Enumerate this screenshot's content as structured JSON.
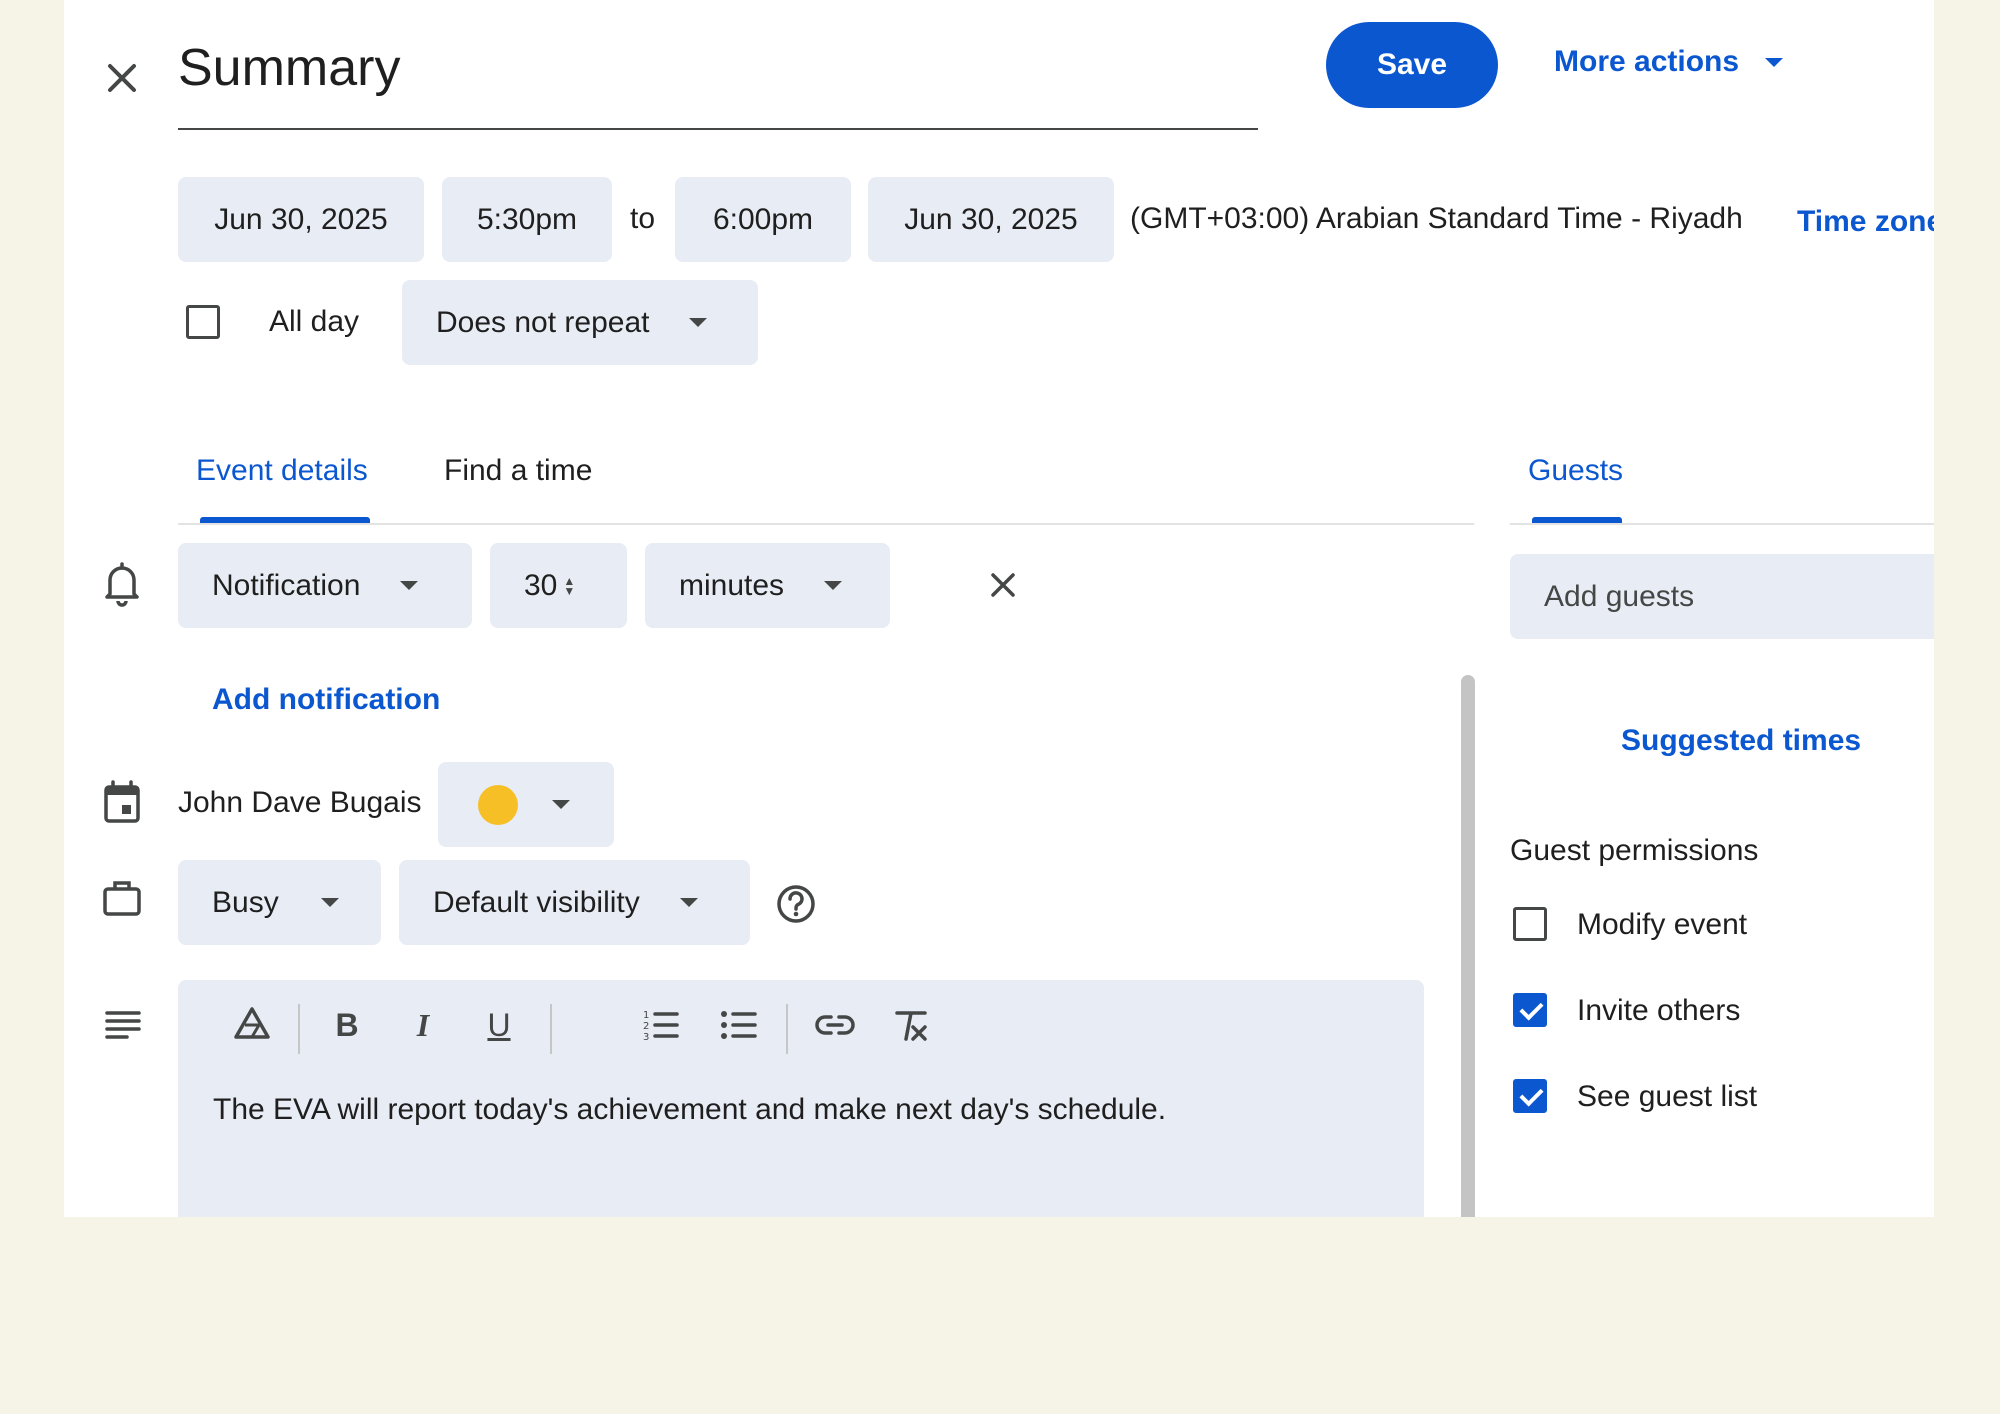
{
  "header": {
    "title": "Summary",
    "save_label": "Save",
    "more_actions_label": "More actions"
  },
  "datetime": {
    "start_date": "Jun 30, 2025",
    "start_time": "5:30pm",
    "to_label": "to",
    "end_time": "6:00pm",
    "end_date": "Jun 30, 2025",
    "timezone_text": "(GMT+03:00) Arabian Standard Time - Riyadh",
    "timezone_link": "Time zone",
    "all_day_label": "All day",
    "all_day_checked": false,
    "repeat_value": "Does not repeat"
  },
  "tabs": {
    "event_details": "Event details",
    "find_a_time": "Find a time",
    "guests": "Guests"
  },
  "notification": {
    "type": "Notification",
    "amount": "30",
    "unit": "minutes",
    "add_label": "Add notification"
  },
  "calendar": {
    "owner": "John Dave Bugais",
    "color": "#f6bf26"
  },
  "availability": {
    "status": "Busy",
    "visibility": "Default visibility"
  },
  "description": {
    "text": "The EVA will report today's achievement and make next day's schedule."
  },
  "guests": {
    "placeholder": "Add guests",
    "suggested_times": "Suggested times",
    "permissions_title": "Guest permissions",
    "permissions": [
      {
        "label": "Modify event",
        "checked": false
      },
      {
        "label": "Invite others",
        "checked": true
      },
      {
        "label": "See guest list",
        "checked": true
      }
    ]
  },
  "colors": {
    "accent": "#0b57d0",
    "chip_bg": "#e8ecf4",
    "page_bg": "#f6f3e7"
  }
}
